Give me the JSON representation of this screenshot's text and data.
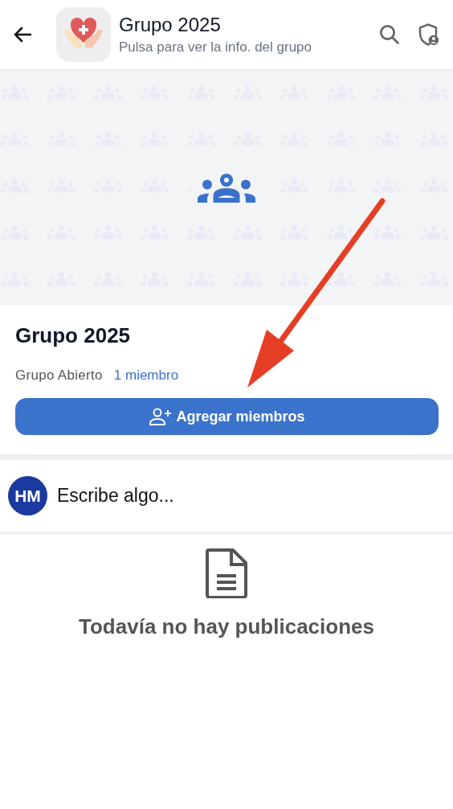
{
  "header": {
    "title": "Grupo 2025",
    "subtitle": "Pulsa para ver la info. del grupo"
  },
  "group": {
    "name": "Grupo 2025",
    "type": "Grupo Abierto",
    "members": "1 miembro",
    "add_button": "Agregar miembros"
  },
  "composer": {
    "avatar": "HM",
    "placeholder": "Escribe algo..."
  },
  "empty_state": {
    "message": "Todavía no hay publicaciones"
  }
}
